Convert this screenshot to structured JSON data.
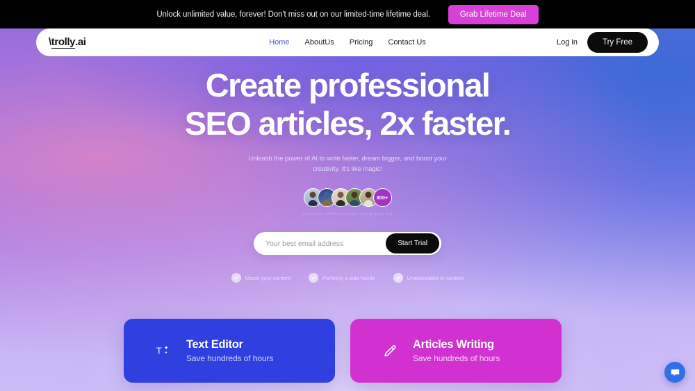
{
  "announcement": {
    "text": "Unlock unlimited value, forever! Don't miss out on our limited-time lifetime deal.",
    "button_label": "Grab Lifetime Deal",
    "button_color": "#d93fd9",
    "background": "#000000"
  },
  "nav": {
    "logo": "\\trolly.ai",
    "links": [
      {
        "label": "Home",
        "active": true
      },
      {
        "label": "AboutUs",
        "active": false
      },
      {
        "label": "Pricing",
        "active": false
      },
      {
        "label": "Contact Us",
        "active": false
      }
    ],
    "login_label": "Log in",
    "cta_label": "Try Free",
    "active_color": "#4b57e6"
  },
  "hero": {
    "headline_line1": "Create professional",
    "headline_line2": "SEO articles, 2x faster.",
    "subtitle": "Unleash the power of AI to write faster, dream bigger, and boost your creativity. It's like magic!",
    "social_proof": {
      "badge_label": "300+",
      "caption": "More than 300+ users are having more fun",
      "avatar_count": 5
    },
    "form": {
      "placeholder": "Your best email address",
      "value": "",
      "submit_label": "Start Trial"
    },
    "features": [
      {
        "label": "Match your content",
        "icon": "check-icon"
      },
      {
        "label": "Perfectly a side hustle",
        "icon": "check-icon"
      },
      {
        "label": "Undetectable AI content",
        "icon": "check-icon"
      }
    ]
  },
  "cards": [
    {
      "title": "Text Editor",
      "subtitle": "Save hundreds of hours",
      "icon": "text-sparkle-icon",
      "color": "#2f3fe0"
    },
    {
      "title": "Articles Writing",
      "subtitle": "Save hundreds of hours",
      "icon": "pencil-icon",
      "color": "#d231d2"
    }
  ],
  "chat_widget": {
    "icon": "chat-bubble-icon",
    "color": "#2f6fe8"
  }
}
